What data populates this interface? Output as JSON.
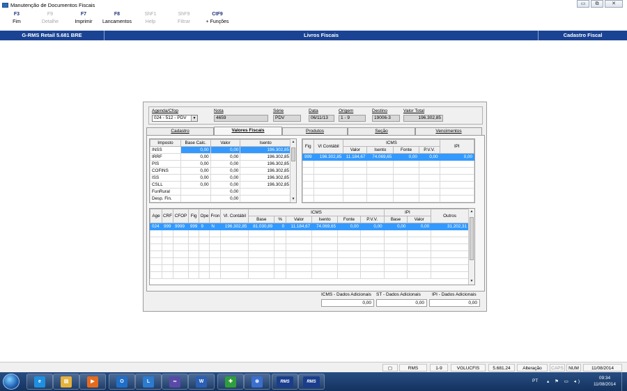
{
  "window": {
    "title": "Manutenção de Documentos Fiscais",
    "btn_min": "▭",
    "btn_max": "⧉",
    "btn_close": "✕"
  },
  "toolbar": [
    {
      "key": "F3",
      "label": "Fim",
      "enabled": true
    },
    {
      "key": "F9",
      "label": "Detalhe",
      "enabled": false
    },
    {
      "key": "F7",
      "label": "Imprimir",
      "enabled": true
    },
    {
      "key": "F8",
      "label": "Lancamentos",
      "enabled": true
    },
    {
      "key": "ShF1",
      "label": "Help",
      "enabled": false
    },
    {
      "key": "ShF9",
      "label": "Filtrar",
      "enabled": false
    },
    {
      "key": "CtF9",
      "label": "+ Funções",
      "enabled": true
    }
  ],
  "band": {
    "left": "G-RMS Retail 5.681 BRE",
    "center": "Livros Fiscais",
    "right": "Cadastro Fiscal"
  },
  "header": {
    "agenda_label": "Agenda/Cfop",
    "agenda_value": "024 - 512 - PDV",
    "nota_label": "Nota",
    "nota_value": "4659",
    "serie_label": "Série",
    "serie_value": "PDV",
    "data_label": "Data",
    "data_value": "06/11/13",
    "origem_label": "Origem",
    "origem_value": "1 - 9",
    "destino_label": "Destino",
    "destino_value": "19006-3",
    "total_label": "Valor Total",
    "total_value": "196.302,85"
  },
  "tabs": [
    {
      "label": "Cadastro",
      "active": false
    },
    {
      "label": "Valores Fiscais",
      "active": true
    },
    {
      "label": "Produtos",
      "active": false
    },
    {
      "label": "Seção",
      "active": false
    },
    {
      "label": "Vencimentos",
      "active": false
    }
  ],
  "impostos": {
    "headers": [
      "Imposto",
      "Base Calc.",
      "Valor",
      "Isento"
    ],
    "rows": [
      [
        "INSS",
        "0,00",
        "0,00",
        "196.302,85"
      ],
      [
        "IRRF",
        "0,00",
        "0,00",
        "196.302,85"
      ],
      [
        "PIS",
        "0,00",
        "0,00",
        "196.302,85"
      ],
      [
        "COFINS",
        "0,00",
        "0,00",
        "196.302,85"
      ],
      [
        "ISS",
        "0,00",
        "0,00",
        "196.302,85"
      ],
      [
        "CSLL",
        "0,00",
        "0,00",
        "196.302,85"
      ],
      [
        "FunRural",
        "",
        "0,00",
        ""
      ],
      [
        "Desp. Fin.",
        "",
        "0,00",
        ""
      ]
    ]
  },
  "icms_right": {
    "h_fig": "Fig",
    "h_vl": "Vl Contábil",
    "h_icms": "ICMS",
    "h_ipi": "IPI",
    "sub": [
      "Valor",
      "Isento",
      "Fonte",
      "P.V.V."
    ],
    "row": [
      "999",
      "196.302,85",
      "11.184,67",
      "74.069,65",
      "0,00",
      "0,00",
      "0,00"
    ]
  },
  "detail": {
    "h_icms": "ICMS",
    "h_ipi": "IPI",
    "cols": [
      "Age",
      "CRF",
      "CFOP",
      "Fig",
      "Ope",
      "Fron",
      "Vl. Contábil",
      "Base",
      "%",
      "Valor",
      "Isento",
      "Fonte",
      "P.V.V.",
      "Base",
      "Valor",
      "Outros"
    ],
    "row": [
      "024",
      "999",
      "9999",
      "999",
      "9",
      "N",
      "196.302,85",
      "81.030,89",
      "0",
      "11.184,67",
      "74.069,65",
      "0,00",
      "0,00",
      "0,00",
      "0,00",
      "31.202,31"
    ]
  },
  "bottom": {
    "icms_label": "ICMS - Dados Adicionais",
    "icms_value": "0,00",
    "st_label": "ST - Dados Adicionais",
    "st_value": "0,00",
    "ipi_label": "IPI - Dados Adicionais",
    "ipi_value": "0,00"
  },
  "status": {
    "app": "RMS",
    "origin": "1-9",
    "program": "VGLUCFIS",
    "version": "5.681.24",
    "mode": "Alteração",
    "caps": "CAPS",
    "num": "NUM",
    "date": "11/08/2014"
  },
  "tray": {
    "lang": "PT",
    "time": "09:34",
    "date": "11/08/2014"
  },
  "taskbar_items": [
    {
      "name": "ie",
      "glyph": "e",
      "color": "#1e8fe0"
    },
    {
      "name": "explorer",
      "glyph": "▤",
      "color": "#e7b23a"
    },
    {
      "name": "media",
      "glyph": "▶",
      "color": "#e56b1f"
    },
    {
      "name": "outlook",
      "glyph": "O",
      "color": "#1f6fc8"
    },
    {
      "name": "lync",
      "glyph": "L",
      "color": "#2b7bd0"
    },
    {
      "name": "app6",
      "glyph": "∞",
      "color": "#5a4aa8"
    },
    {
      "name": "word",
      "glyph": "W",
      "color": "#2b5fb4"
    },
    {
      "name": "app8",
      "glyph": "✚",
      "color": "#2f9d3b"
    },
    {
      "name": "app9",
      "glyph": "⊛",
      "color": "#3a6fd0"
    },
    {
      "name": "rms1",
      "glyph": "RMS",
      "color": "#1a3d8c"
    },
    {
      "name": "rms2",
      "glyph": "RMS",
      "color": "#1a3d8c"
    }
  ]
}
